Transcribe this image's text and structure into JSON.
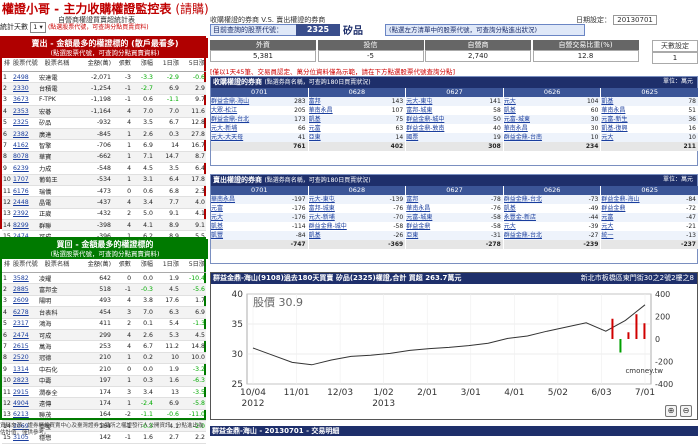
{
  "app_title": "權證小哥 - 主力收購權證監控表",
  "app_title_paren": "(請購)",
  "left": {
    "subtitle": "自營商權證買賣超統計表",
    "filter_label": "統計天數",
    "filter_value": "1",
    "filter_hint": "(點選股票代號，可查詢分點買賣資料)",
    "buy_panel": {
      "title": "賣出 - 金額最多的權證標的 (散戶最看多)",
      "hint": "(點選股票代號，可查詢分點買賣資料)",
      "columns": [
        "排",
        "股票代號",
        "股票名稱",
        "金額(萬)",
        "張數",
        "漲幅",
        "1日漲",
        "5日漲"
      ],
      "rows": [
        [
          "1",
          "2498",
          "宏達電",
          "-2,071",
          "-3",
          "-3.3",
          "-2.9",
          "-0.6"
        ],
        [
          "2",
          "2330",
          "台積電",
          "-1,254",
          "-1",
          "-2.7",
          "6.9",
          "2.9"
        ],
        [
          "3",
          "3673",
          "F-TPK",
          "-1,198",
          "-1",
          "0.6",
          "-1.1",
          "9.7"
        ],
        [
          "4",
          "2353",
          "宏碁",
          "-1,164",
          "4",
          "7.0",
          "7.0",
          "11.6"
        ],
        [
          "5",
          "2325",
          "矽品",
          "-932",
          "4",
          "3.5",
          "6.7",
          "12.8"
        ],
        [
          "6",
          "2382",
          "廣達",
          "-845",
          "1",
          "2.6",
          "0.3",
          "27.8"
        ],
        [
          "7",
          "4162",
          "智擎",
          "-706",
          "1",
          "6.9",
          "14",
          "16.7"
        ],
        [
          "8",
          "8078",
          "華寶",
          "-662",
          "1",
          "7.1",
          "14.7",
          "8.7"
        ],
        [
          "9",
          "6239",
          "力成",
          "-548",
          "4",
          "4.5",
          "3.5",
          "6.4"
        ],
        [
          "10",
          "1707",
          "葡萄王",
          "-534",
          "1",
          "3.1",
          "6.4",
          "17.8"
        ],
        [
          "11",
          "6176",
          "瑞儀",
          "-473",
          "0",
          "0.6",
          "6.8",
          "2.3"
        ],
        [
          "12",
          "2448",
          "晶電",
          "-437",
          "4",
          "3.4",
          "7.7",
          "4.0"
        ],
        [
          "13",
          "2392",
          "正崴",
          "-432",
          "2",
          "5.0",
          "9.1",
          "4.1"
        ],
        [
          "14",
          "8299",
          "群聯",
          "-398",
          "4",
          "4.1",
          "8.9",
          "9.1"
        ],
        [
          "15",
          "2474",
          "可成",
          "-396",
          "1",
          "6.2",
          "8.9",
          "5.5"
        ]
      ]
    },
    "sell_panel": {
      "title": "買回 - 金額最多的權證標的",
      "hint": "(點選股票代號，可查詢分點買賣資料)",
      "columns": [
        "排",
        "股票代號",
        "股票名稱",
        "金額(萬)",
        "張數",
        "漲幅",
        "1日漲",
        "5日漲"
      ],
      "rows": [
        [
          "1",
          "3582",
          "凌耀",
          "642",
          "0",
          "0.0",
          "1.9",
          "-10.4"
        ],
        [
          "2",
          "2885",
          "富邦金",
          "518",
          "-1",
          "-0.3",
          "4.5",
          "-5.6"
        ],
        [
          "3",
          "2609",
          "陽明",
          "493",
          "4",
          "3.8",
          "17.6",
          "1.7"
        ],
        [
          "4",
          "6278",
          "台表科",
          "454",
          "3",
          "7.0",
          "6.3",
          "6.9"
        ],
        [
          "5",
          "2317",
          "鴻海",
          "411",
          "2",
          "0.1",
          "5.4",
          "-1.3"
        ],
        [
          "6",
          "2474",
          "可成",
          "299",
          "4",
          "2.6",
          "5.3",
          "4.5"
        ],
        [
          "7",
          "2615",
          "萬海",
          "253",
          "4",
          "6.7",
          "11.2",
          "14.8"
        ],
        [
          "8",
          "2520",
          "冠德",
          "210",
          "1",
          "0.2",
          "10",
          "10.0"
        ],
        [
          "9",
          "1314",
          "中石化",
          "210",
          "0",
          "0.0",
          "1.9",
          "-3.2"
        ],
        [
          "10",
          "2823",
          "中壽",
          "197",
          "1",
          "0.3",
          "1.6",
          "-6.3"
        ],
        [
          "11",
          "2915",
          "潤泰全",
          "174",
          "3",
          "3.4",
          "13",
          "-3.5"
        ],
        [
          "12",
          "4904",
          "遠傳",
          "174",
          "1",
          "-2.4",
          "6.9",
          "-5.8"
        ],
        [
          "13",
          "6213",
          "聯茂",
          "164",
          "-2",
          "-1.1",
          "-0.6",
          "-11.0"
        ],
        [
          "14",
          "2069",
          "亞瑩",
          "164",
          "-1",
          "-0.3",
          "4.1",
          "-2.0"
        ],
        [
          "15",
          "3105",
          "穩懋",
          "142",
          "-1",
          "1.6",
          "2.7",
          "2.2"
        ]
      ]
    },
    "footnote": "資料來源：證券櫃檯買賣中心及臺灣證券交易所之權證發行人公開資訊，分點進出為估計值，僅供參考。"
  },
  "right": {
    "subtitle": "收購權證的券商 V.S. 賣出權證的券商",
    "date_label": "日期設定：",
    "date_value": "20130701",
    "query_label": "目前查詢的股票代號：",
    "stock_code": "2325",
    "stock_name": "矽品",
    "query_hint": "(點選左方清單中的股票代號，可查詢分點進出狀況)",
    "stats": {
      "headers": [
        "外資",
        "投信",
        "自營商",
        "自營交易比重(%)"
      ],
      "values": [
        "5,381",
        "-5",
        "2,740",
        "12.8"
      ]
    },
    "days_label": "天數設定",
    "days_value": "1",
    "notice": "[僅以1天45筆、交易員認定、萬分位資料僅為示範，請在下方點選股票代號查詢分點]",
    "buy_section": {
      "title": "收購權證的券商",
      "note": "(點選券商名稱，可查詢180日買賣狀況)",
      "unit": "單位：萬元",
      "dates": [
        "0701",
        "0628",
        "0627",
        "0626",
        "0625"
      ],
      "columns": [
        [
          [
            "群益金鼎-海山",
            "283"
          ],
          [
            "大眾-松江",
            "205"
          ],
          [
            "群益金鼎-台北",
            "173"
          ],
          [
            "元大-新埔",
            "66"
          ],
          [
            "元大-大天母",
            "41"
          ]
        ],
        [
          [
            "富邦",
            "143"
          ],
          [
            "華南永昌",
            "107"
          ],
          [
            "凱基",
            "75"
          ],
          [
            "元富",
            "63"
          ],
          [
            "亞東",
            "14"
          ]
        ],
        [
          [
            "元大-東屯",
            "141"
          ],
          [
            "富邦-城東",
            "58"
          ],
          [
            "群益金鼎-城中",
            "50"
          ],
          [
            "群益金鼎-敦南",
            "40"
          ],
          [
            "國票",
            "19"
          ]
        ],
        [
          [
            "元大",
            "104"
          ],
          [
            "凱基",
            "60"
          ],
          [
            "元富-城東",
            "30"
          ],
          [
            "華南永昌",
            "30"
          ],
          [
            "群益金鼎-台南",
            "10"
          ]
        ],
        [
          [
            "凱基",
            "78"
          ],
          [
            "華南永昌",
            "51"
          ],
          [
            "元富-新生",
            "36"
          ],
          [
            "凱基-復興",
            "16"
          ],
          [
            "元大",
            "10"
          ]
        ]
      ],
      "totals": [
        "761",
        "402",
        "308",
        "234",
        "211"
      ]
    },
    "sell_section": {
      "title": "賣出權證的券商",
      "note": "(點選券商名稱，可查詢180日買賣狀況)",
      "unit": "單位：萬元",
      "dates": [
        "0701",
        "0628",
        "0627",
        "0626",
        "0625"
      ],
      "columns": [
        [
          [
            "華南永昌",
            "-197"
          ],
          [
            "元富",
            "-176"
          ],
          [
            "元大",
            "-176"
          ],
          [
            "凱基",
            "-114"
          ],
          [
            "凱豐",
            "-84"
          ]
        ],
        [
          [
            "元大-東屯",
            "-139"
          ],
          [
            "富邦-城東",
            "-76"
          ],
          [
            "元大-新埔",
            "-70"
          ],
          [
            "群益金鼎-城中",
            "-58"
          ],
          [
            "凱基",
            "-26"
          ]
        ],
        [
          [
            "富邦",
            "-78"
          ],
          [
            "華南永昌",
            "-76"
          ],
          [
            "元富-城東",
            "-58"
          ],
          [
            "群益金鼎",
            "-58"
          ],
          [
            "亞東",
            "-31"
          ]
        ],
        [
          [
            "群益金鼎-台北",
            "-73"
          ],
          [
            "凱基",
            "-49"
          ],
          [
            "永豐金-新店",
            "-44"
          ],
          [
            "元大",
            "-39"
          ],
          [
            "群益金鼎-台北",
            "-27"
          ]
        ],
        [
          [
            "群益金鼎-海山",
            "-84"
          ],
          [
            "群益金鼎",
            "-72"
          ],
          [
            "元富",
            "-47"
          ],
          [
            "元大",
            "-21"
          ],
          [
            "統一",
            "-13"
          ]
        ]
      ],
      "totals": [
        "-747",
        "-369",
        "-278",
        "-239",
        "-237"
      ]
    },
    "chart_section": {
      "title": "群益金鼎-海山(9108)過去180天買賣 矽品(2325)權證,合計 買超 263.7萬元",
      "address": "新北市板橋區東門街30之2號2樓之8",
      "watermark": "cmoney.tw",
      "bottom_title": "群益金鼎-海山 - 20130701 - 交易明細"
    }
  },
  "chart_data": {
    "type": "line",
    "title": "",
    "series": [
      {
        "name": "股價",
        "color": "#333333",
        "values": [
          [
            "10/04",
            31.0
          ],
          [
            "10/15",
            29.8
          ],
          [
            "10/25",
            28.6
          ],
          [
            "11/01",
            28.2
          ],
          [
            "11/15",
            29.0
          ],
          [
            "11/30",
            29.6
          ],
          [
            "12/03",
            29.8
          ],
          [
            "12/20",
            30.1
          ],
          [
            "1/03",
            30.6
          ],
          [
            "1/20",
            30.9
          ],
          [
            "2/01",
            31.1
          ],
          [
            "2/20",
            31.4
          ],
          [
            "3/01",
            31.8
          ],
          [
            "3/20",
            32.6
          ],
          [
            "4/01",
            33.0
          ],
          [
            "4/20",
            33.8
          ],
          [
            "5/02",
            34.5
          ],
          [
            "5/20",
            35.2
          ],
          [
            "6/03",
            33.8
          ],
          [
            "6/20",
            35.6
          ],
          [
            "7/01",
            38.2
          ]
        ]
      }
    ],
    "bars": [
      {
        "x": "6/08",
        "value": 180,
        "color": "#d00000"
      },
      {
        "x": "6/10",
        "value": -120,
        "color": "#00a000"
      },
      {
        "x": "6/20",
        "value": 60,
        "color": "#d00000"
      },
      {
        "x": "6/28",
        "value": 220,
        "color": "#d00000"
      },
      {
        "x": "7/01",
        "value": 140,
        "color": "#d00000"
      }
    ],
    "xlabel": "",
    "ylabel": "股價",
    "ylim": [
      25,
      40
    ],
    "bar_ylim": [
      -400,
      400
    ],
    "price_label": "股價 30.9",
    "yticks": [
      25,
      30,
      35,
      40
    ],
    "right_yticks": [
      "400",
      "200",
      "0",
      "-200",
      "-400"
    ],
    "xticks": [
      "10/04",
      "11/01",
      "12/03",
      "1/02",
      "2/01",
      "3/01",
      "4/01",
      "5/02",
      "6/03",
      "7/01"
    ],
    "xtick_years": [
      "2012",
      "",
      "",
      "2013",
      "",
      "",
      "",
      "",
      "",
      ""
    ],
    "grid": true
  },
  "colors": {
    "buy_header": "#b00000",
    "sell_header": "#007a00",
    "navy": "#1e2f6b",
    "blue": "#3b5597",
    "link": "#1a3e9e"
  }
}
